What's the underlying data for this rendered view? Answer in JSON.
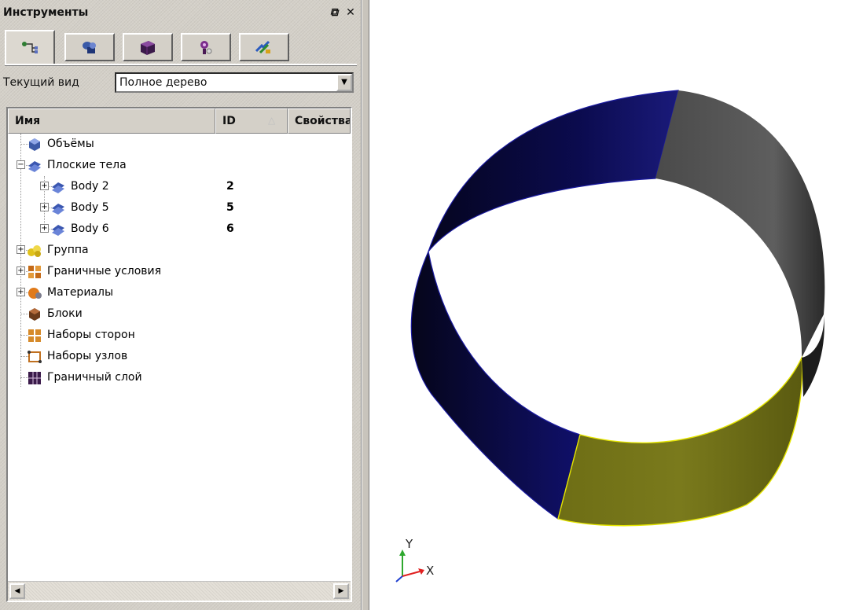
{
  "panel": {
    "title": "Инструменты",
    "float_icon": "⧉",
    "close_icon": "✕"
  },
  "tabs": [
    {
      "icon": "tree-icon"
    },
    {
      "icon": "geometry-icon"
    },
    {
      "icon": "mesh-icon"
    },
    {
      "icon": "properties-icon"
    },
    {
      "icon": "settings-icon"
    }
  ],
  "view": {
    "label": "Текущий вид",
    "selected": "Полное дерево"
  },
  "tree": {
    "columns": [
      "Имя",
      "ID",
      "Свойства"
    ],
    "items": [
      {
        "label": "Объёмы",
        "id": "",
        "level": 0,
        "expander": "",
        "icon": "volumes-icon"
      },
      {
        "label": "Плоские тела",
        "id": "",
        "level": 0,
        "expander": "−",
        "icon": "sheet-bodies-icon"
      },
      {
        "label": "Body 2",
        "id": "2",
        "level": 1,
        "expander": "+",
        "icon": "body-icon"
      },
      {
        "label": "Body 5",
        "id": "5",
        "level": 1,
        "expander": "+",
        "icon": "body-icon"
      },
      {
        "label": "Body 6",
        "id": "6",
        "level": 1,
        "expander": "+",
        "icon": "body-icon"
      },
      {
        "label": "Группа",
        "id": "",
        "level": 0,
        "expander": "+",
        "icon": "group-icon"
      },
      {
        "label": "Граничные условия",
        "id": "",
        "level": 0,
        "expander": "+",
        "icon": "boundary-conditions-icon"
      },
      {
        "label": "Материалы",
        "id": "",
        "level": 0,
        "expander": "+",
        "icon": "materials-icon"
      },
      {
        "label": "Блоки",
        "id": "",
        "level": 0,
        "expander": "",
        "icon": "blocks-icon"
      },
      {
        "label": "Наборы сторон",
        "id": "",
        "level": 0,
        "expander": "",
        "icon": "sidesets-icon"
      },
      {
        "label": "Наборы узлов",
        "id": "",
        "level": 0,
        "expander": "",
        "icon": "nodesets-icon"
      },
      {
        "label": "Граничный слой",
        "id": "",
        "level": 0,
        "expander": "",
        "icon": "boundary-layer-icon"
      }
    ]
  },
  "viewport": {
    "axis_x": "X",
    "axis_y": "Y",
    "surface_colors": {
      "body_2": "#0b0b6a",
      "body_5": "#5a5a5a",
      "body_6": "#7a7a1a"
    }
  }
}
